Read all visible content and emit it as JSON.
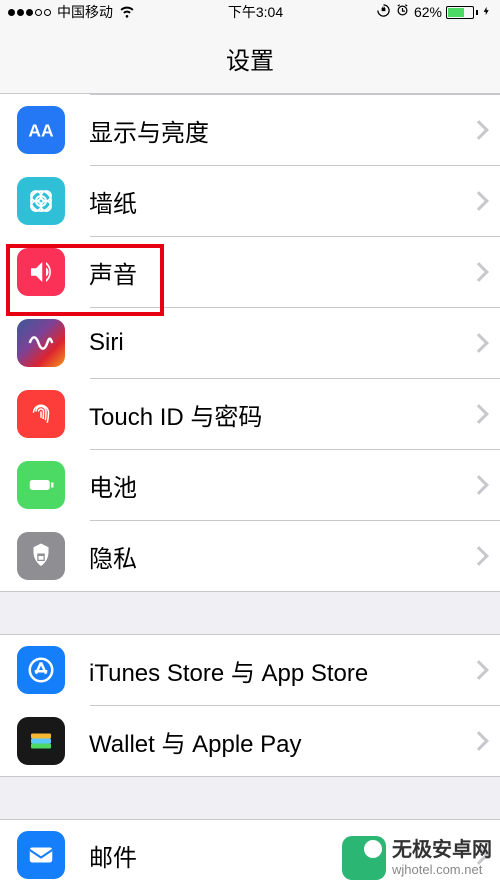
{
  "status": {
    "carrier": "中国移动",
    "time": "下午3:04",
    "battery_percent": "62%"
  },
  "header": {
    "title": "设置"
  },
  "rows": {
    "display": "显示与亮度",
    "wallpaper": "墙纸",
    "sounds": "声音",
    "siri": "Siri",
    "touchid": "Touch ID 与密码",
    "battery": "电池",
    "privacy": "隐私",
    "itunes": "iTunes Store 与 App Store",
    "wallet": "Wallet 与 Apple Pay",
    "mail": "邮件"
  },
  "watermark": {
    "title": "无极安卓网",
    "url": "wjhotel.com.net"
  }
}
